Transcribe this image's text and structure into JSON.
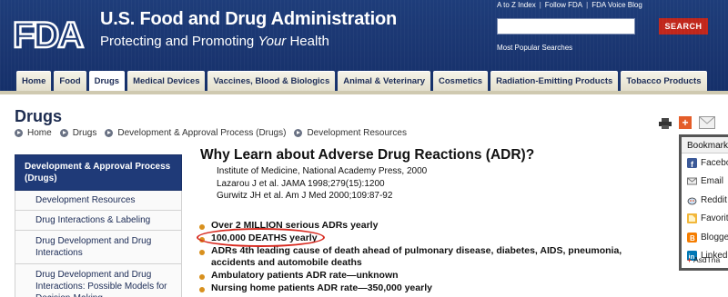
{
  "header": {
    "logo_text": "FDA",
    "agency_name": "U.S. Food and Drug Administration",
    "tagline_prefix": "Protecting and Promoting ",
    "tagline_emphasis": "Your",
    "tagline_suffix": " Health",
    "util_links": [
      "A to Z Index",
      "Follow FDA",
      "FDA Voice Blog"
    ],
    "search_placeholder": "",
    "search_button": "SEARCH",
    "popular_link": "Most Popular Searches"
  },
  "nav": {
    "tabs": [
      "Home",
      "Food",
      "Drugs",
      "Medical Devices",
      "Vaccines, Blood & Biologics",
      "Animal & Veterinary",
      "Cosmetics",
      "Radiation-Emitting Products",
      "Tobacco Products"
    ],
    "active_index": 2
  },
  "page": {
    "title": "Drugs",
    "breadcrumb": [
      "Home",
      "Drugs",
      "Development & Approval Process (Drugs)",
      "Development Resources"
    ]
  },
  "sidebar": {
    "heading": "Development & Approval Process (Drugs)",
    "items": [
      "Development Resources",
      "Drug Interactions & Labeling",
      "Drug Development and Drug Interactions",
      "Drug Development and Drug Interactions: Possible Models for Decision-Making"
    ]
  },
  "main": {
    "heading": "Why Learn about Adverse Drug Reactions (ADR)?",
    "references": [
      "Institute of Medicine, National Academy Press, 2000",
      "Lazarou J et al. JAMA 1998;279(15):1200",
      "Gurwitz JH et al. Am J Med 2000;109:87-92"
    ],
    "facts": [
      "Over 2 MILLION serious ADRs yearly",
      "100,000 DEATHS yearly",
      "ADRs 4th leading cause of death ahead of pulmonary disease, diabetes, AIDS, pneumonia,",
      "accidents and automobile deaths",
      "Ambulatory patients ADR rate—unknown",
      "Nursing home patients ADR rate—350,000 yearly"
    ]
  },
  "bookmark": {
    "title": "Bookmark",
    "items": [
      "Facebook",
      "Email",
      "Reddit",
      "Favorites",
      "Blogger",
      "LinkedIn"
    ],
    "footer": "AsdTna"
  },
  "colors": {
    "header_bg": "#1a3570",
    "search_button": "#c0261b",
    "sidebar_head": "#1f3a78",
    "bullet": "#d8901e",
    "annotation_circle": "#d7291f"
  }
}
